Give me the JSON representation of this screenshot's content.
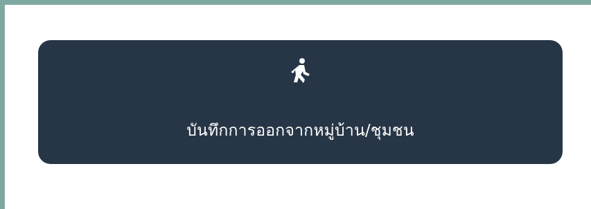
{
  "action_card": {
    "label": "บันทึกการออกจากหมู่บ้าน/ชุมชน",
    "icon": "walking-person-icon",
    "background_color": "#273647",
    "text_color": "#ffffff"
  },
  "page": {
    "frame_color": "#7fa8a0",
    "background_color": "#ffffff"
  }
}
